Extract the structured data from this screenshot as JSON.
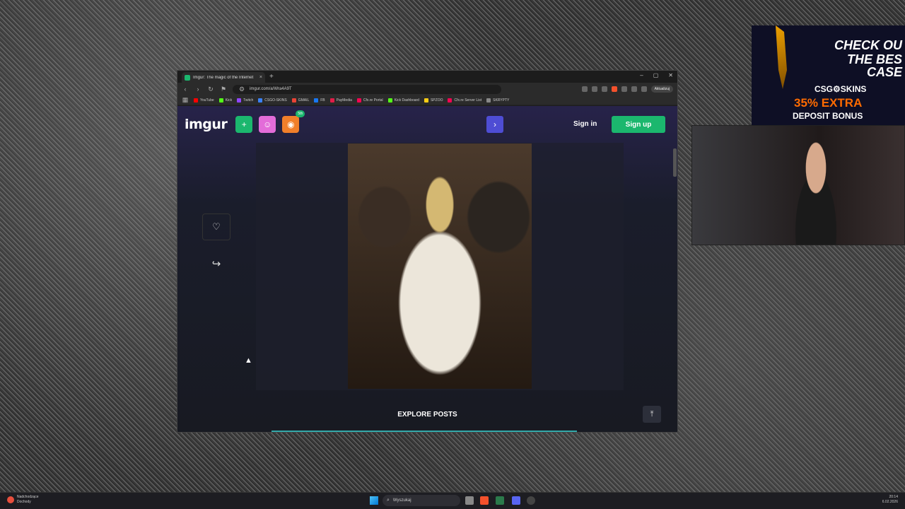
{
  "browser": {
    "tab_title": "Imgur: The magic of the Internet",
    "tab_close": "×",
    "new_tab": "+",
    "url": "imgur.com/a/Wra4A9T",
    "update_label": "Aktualizuj",
    "window_controls": [
      "–",
      "▢",
      "✕"
    ],
    "bookmarks": [
      {
        "label": "YouTube",
        "color": "#ff0000"
      },
      {
        "label": "Kick",
        "color": "#53fc18"
      },
      {
        "label": "Twitch",
        "color": "#9146ff"
      },
      {
        "label": "CSGO-SKINS",
        "color": "#3b82f6"
      },
      {
        "label": "GMAIL",
        "color": "#ea4335"
      },
      {
        "label": "FB",
        "color": "#1877f2"
      },
      {
        "label": "PayMedia",
        "color": "#e11d48"
      },
      {
        "label": "Cfx.re Portal",
        "color": "#f40552"
      },
      {
        "label": "Kick Dashboard",
        "color": "#53fc18"
      },
      {
        "label": "SPZOO",
        "color": "#facc15"
      },
      {
        "label": "Cfx.re Server List",
        "color": "#f40552"
      },
      {
        "label": "SKRYPTY",
        "color": "#888888"
      }
    ]
  },
  "imgur": {
    "logo": "imgur",
    "badge": "5th",
    "sign_in": "Sign in",
    "sign_up": "Sign up",
    "explore_posts": "EXPLORE POSTS",
    "icons": {
      "upload": "+",
      "meme": "☺",
      "games": "◉",
      "next": "›",
      "heart": "♡",
      "share": "↪",
      "to_top": "⤒"
    }
  },
  "ad": {
    "line1": "CHECK OU",
    "line2": "THE BES",
    "line3": "CASE",
    "brand": "CSG⚙SKINS",
    "bonus1": "35% EXTRA",
    "bonus2": "DEPOSIT BONUS"
  },
  "taskbar": {
    "weather_line1": "Nadchodzące",
    "weather_line2": "Dochody",
    "search_placeholder": "Wyszukaj",
    "time": "20:14",
    "date": "6.02.2026"
  }
}
